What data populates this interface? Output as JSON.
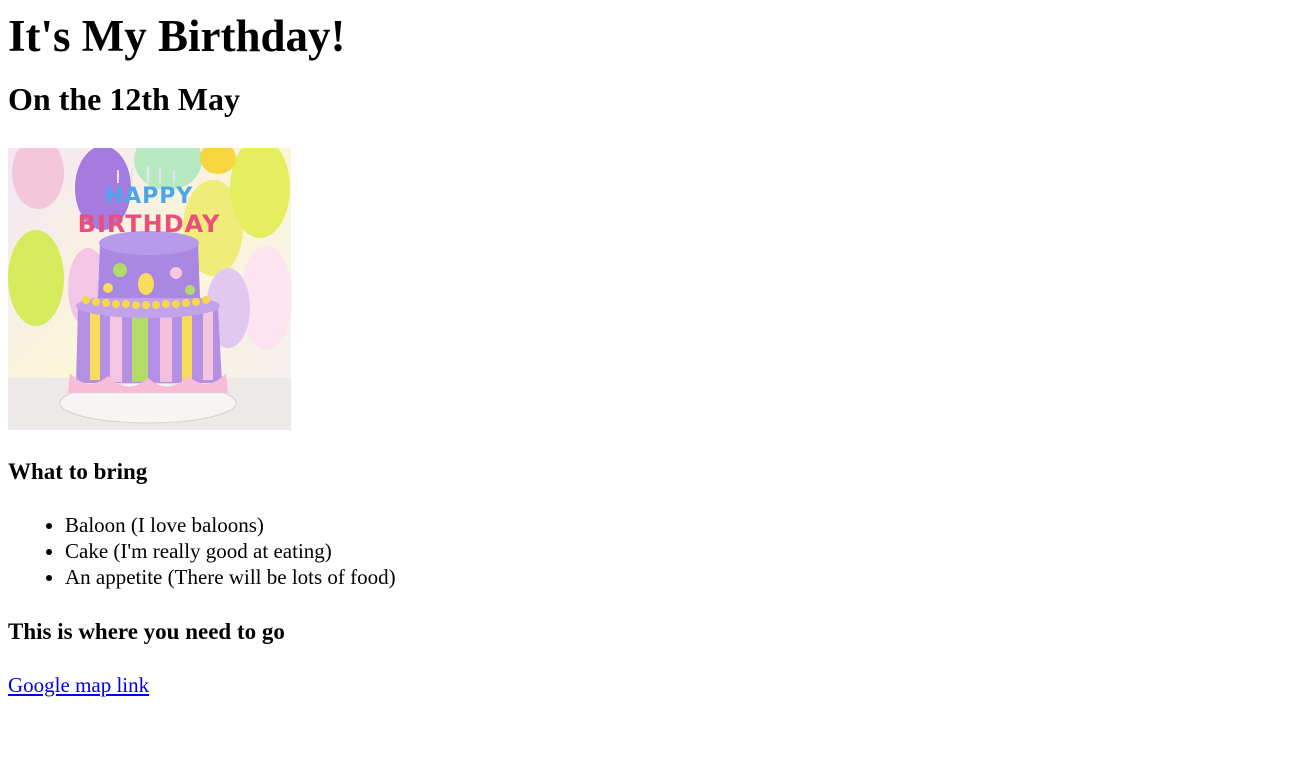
{
  "header": {
    "title": "It's My Birthday!",
    "subtitle": "On the 12th May"
  },
  "image": {
    "alt": "Happy birthday cake with balloons",
    "banner_text": "HAPPY BIRTHDAY"
  },
  "bring": {
    "heading": "What to bring",
    "items": [
      "Baloon (I love baloons)",
      "Cake (I'm really good at eating)",
      "An appetite (There will be lots of food)"
    ]
  },
  "location": {
    "heading": "This is where you need to go",
    "link_label": "Google map link"
  }
}
